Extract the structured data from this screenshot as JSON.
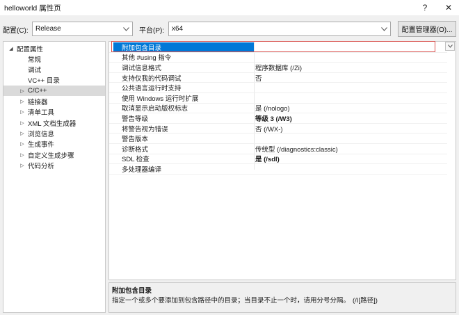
{
  "window": {
    "title": "helloworld 属性页",
    "help_label": "?",
    "close_label": "✕"
  },
  "toolbar": {
    "config_label": "配置(C):",
    "config_value": "Release",
    "platform_label": "平台(P):",
    "platform_value": "x64",
    "config_manager_label": "配置管理器(O)..."
  },
  "tree": {
    "items": [
      {
        "label": "配置属性",
        "expander": "◢",
        "level": 0
      },
      {
        "label": "常规",
        "expander": "",
        "level": 1
      },
      {
        "label": "调试",
        "expander": "",
        "level": 1
      },
      {
        "label": "VC++ 目录",
        "expander": "",
        "level": 1
      },
      {
        "label": "C/C++",
        "expander": "▷",
        "level": 1,
        "selected": true
      },
      {
        "label": "链接器",
        "expander": "▷",
        "level": 1
      },
      {
        "label": "清单工具",
        "expander": "▷",
        "level": 1
      },
      {
        "label": "XML 文档生成器",
        "expander": "▷",
        "level": 1
      },
      {
        "label": "浏览信息",
        "expander": "▷",
        "level": 1
      },
      {
        "label": "生成事件",
        "expander": "▷",
        "level": 1
      },
      {
        "label": "自定义生成步骤",
        "expander": "▷",
        "level": 1
      },
      {
        "label": "代码分析",
        "expander": "▷",
        "level": 1
      }
    ]
  },
  "properties": [
    {
      "name": "附加包含目录",
      "value": "",
      "selected": true
    },
    {
      "name": "其他 #using 指令",
      "value": ""
    },
    {
      "name": "调试信息格式",
      "value": "程序数据库 (/Zi)"
    },
    {
      "name": "支持仅我的代码调试",
      "value": "否"
    },
    {
      "name": "公共语言运行时支持",
      "value": ""
    },
    {
      "name": "使用 Windows 运行时扩展",
      "value": ""
    },
    {
      "name": "取消显示启动版权标志",
      "value": "是 (/nologo)"
    },
    {
      "name": "警告等级",
      "value": "等级 3 (/W3)",
      "bold": true
    },
    {
      "name": "将警告视为错误",
      "value": "否 (/WX-)"
    },
    {
      "name": "警告版本",
      "value": ""
    },
    {
      "name": "诊断格式",
      "value": "传统型 (/diagnostics:classic)"
    },
    {
      "name": "SDL 检查",
      "value": "是 (/sdl)",
      "bold": true
    },
    {
      "name": "多处理器编译",
      "value": ""
    }
  ],
  "description": {
    "title": "附加包含目录",
    "text": "指定一个或多个要添加到包含路径中的目录；当目录不止一个时，请用分号分隔。",
    "switch": "(/I[路径])"
  },
  "icons": {
    "dropdown": "chevron-down-icon",
    "expand": "expand-triangle-icon",
    "collapse": "collapse-triangle-icon"
  },
  "colors": {
    "selection": "#0078d7",
    "highlight_outline": "#d9534f",
    "tree_selected": "#dadada"
  }
}
